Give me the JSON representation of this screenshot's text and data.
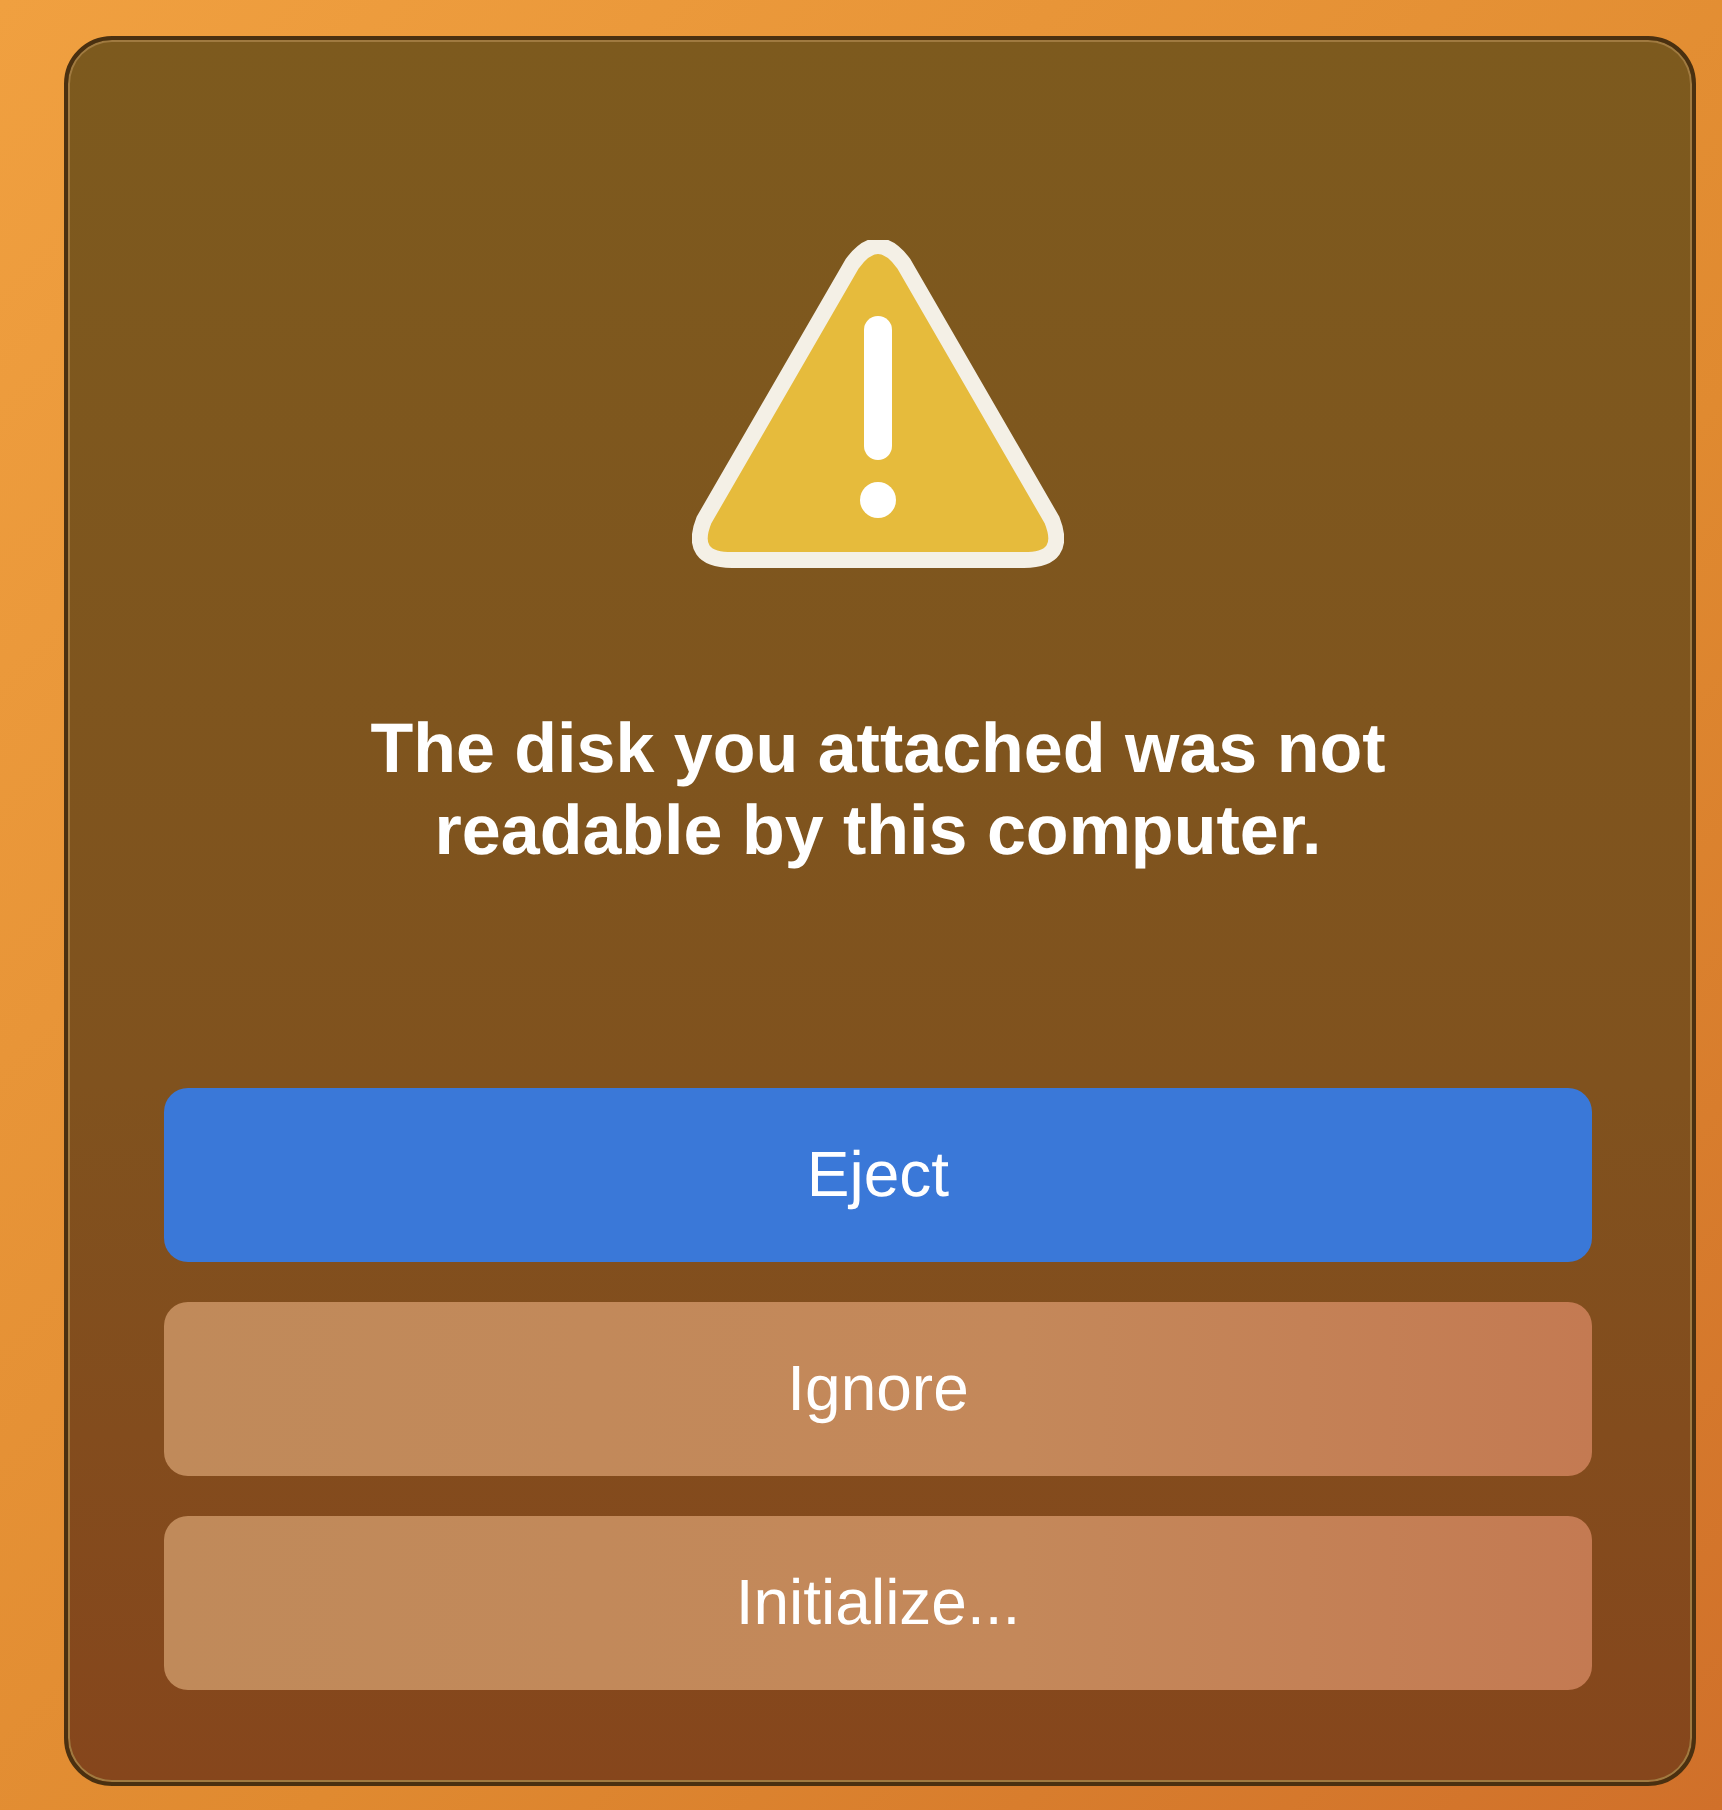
{
  "dialog": {
    "message": "The disk you attached was not readable by this computer.",
    "buttons": [
      {
        "label": "Eject",
        "default": true
      },
      {
        "label": "Ignore",
        "default": false
      },
      {
        "label": "Initialize...",
        "default": false
      }
    ]
  }
}
